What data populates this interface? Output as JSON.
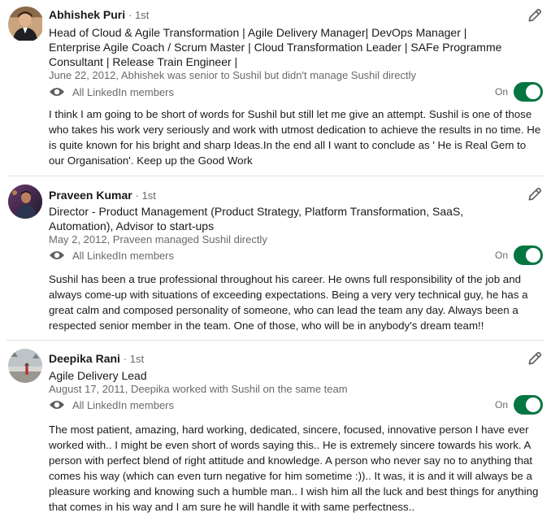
{
  "recommendations": [
    {
      "name": "Abhishek Puri",
      "degree": "· 1st",
      "headline": "Head of Cloud & Agile Transformation | Agile Delivery Manager| DevOps Manager | Enterprise Agile Coach / Scrum Master | Cloud Transformation Leader | SAFe Programme Consultant | Release Train Engineer |",
      "meta": "June 22, 2012, Abhishek was senior to Sushil but didn't manage Sushil directly",
      "visibility": "All LinkedIn members",
      "toggle_label": "On",
      "text": "I think I am going to be short of words for Sushil but still let me give an attempt. Sushil is one of those who takes his work very seriously and work with utmost dedication to achieve the results in no time. He is quite known for his bright and sharp Ideas.In the end all I want to conclude as ' He is Real Gem to our Organisation'. Keep up the Good Work"
    },
    {
      "name": "Praveen Kumar",
      "degree": "· 1st",
      "headline": "Director - Product Management (Product Strategy, Platform Transformation, SaaS, Automation), Advisor to start-ups",
      "meta": "May 2, 2012, Praveen managed Sushil directly",
      "visibility": "All LinkedIn members",
      "toggle_label": "On",
      "text": "Sushil has been a true professional throughout his career. He owns full responsibility of the job and always come-up with situations of exceeding expectations. Being a very very technical guy, he has a great calm and composed personality of someone, who can lead the team any day. Always been a respected senior member in the team. One of those, who will be in anybody's dream team!!"
    },
    {
      "name": "Deepika Rani",
      "degree": "· 1st",
      "headline": "Agile Delivery Lead",
      "meta": "August 17, 2011, Deepika worked with Sushil on the same team",
      "visibility": "All LinkedIn members",
      "toggle_label": "On",
      "text": "The most patient, amazing, hard working, dedicated, sincere, focused, innovative person I have ever worked with.. I might be even short of words saying this.. He is extremely sincere towards his work. A person with perfect blend of right attitude and knowledge. A person who never say no to anything that comes his way (which can even turn negative for him sometime :)).. It was, it is and it will always be a pleasure working and knowing such a humble man.. I wish him all the luck and best things for anything that comes in his way and I am sure he will handle it with same perfectness.."
    }
  ],
  "icons": {
    "edit": "pencil-icon",
    "visibility": "eye-icon"
  },
  "colors": {
    "toggle_on": "#057642",
    "secondary_text": "#666666",
    "divider": "#e3e3e3"
  }
}
